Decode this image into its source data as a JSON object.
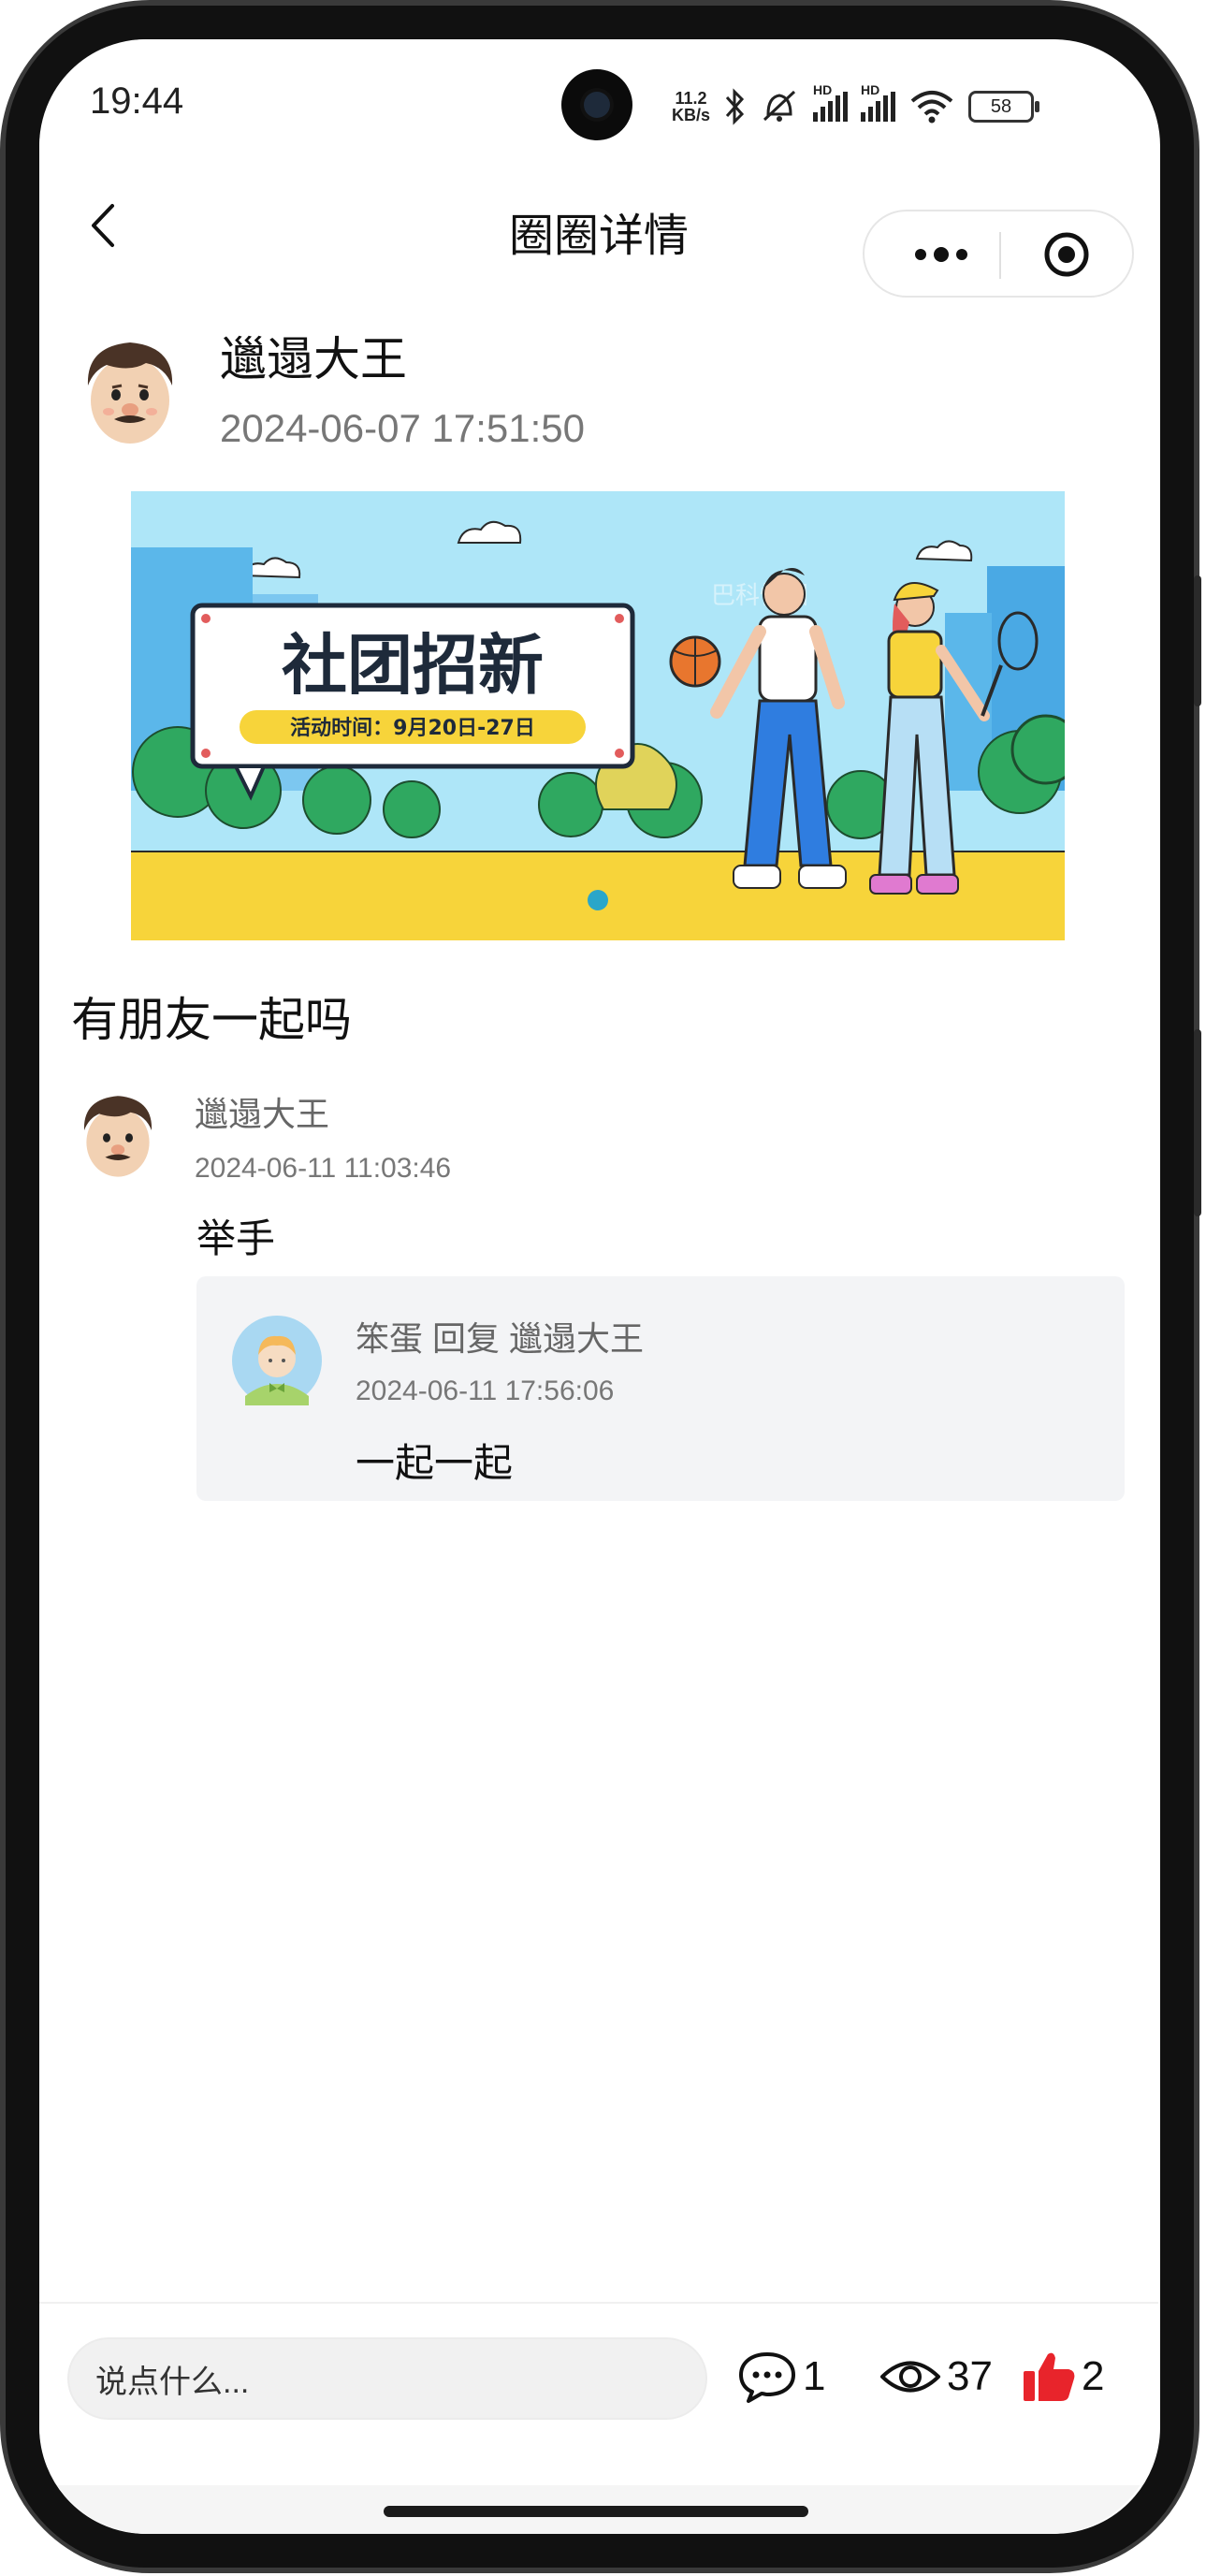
{
  "status_bar": {
    "time": "19:44",
    "net_speed_value": "11.2",
    "net_speed_unit": "KB/s",
    "battery": "58",
    "hd1": "HD",
    "hd2": "HD"
  },
  "nav": {
    "title": "圈圈详情"
  },
  "post": {
    "author": "邋遢大王",
    "time": "2024-06-07 17:51:50",
    "text": "有朋友一起吗",
    "banner": {
      "headline": "社团招新",
      "activity_text": "活动时间：9月20日-27日",
      "watermark": "巴科快图"
    }
  },
  "comment": {
    "author": "邋遢大王",
    "time": "2024-06-11 11:03:46",
    "text": "举手",
    "reply": {
      "header": "笨蛋 回复 邋遢大王",
      "time": "2024-06-11 17:56:06",
      "text": "一起一起"
    }
  },
  "bottom_bar": {
    "input_placeholder": "说点什么...",
    "comment_count": "1",
    "view_count": "37",
    "like_count": "2"
  },
  "colors": {
    "like": "#e8242b",
    "banner_sky": "#a9e4f7",
    "banner_ground": "#f7d43a"
  }
}
